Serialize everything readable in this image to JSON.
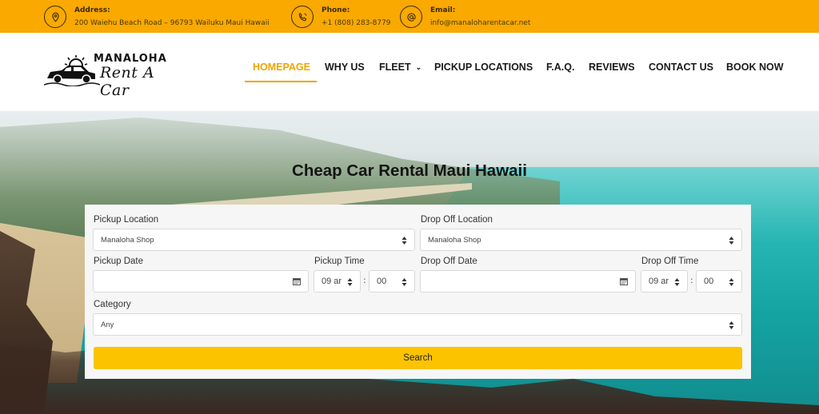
{
  "topbar": {
    "address": {
      "label": "Address:",
      "value": "200 Waiehu Beach Road – 96793 Wailuku Maui Hawaii"
    },
    "phone": {
      "label": "Phone:",
      "value": "+1 (808) 283-8779"
    },
    "email": {
      "label": "Email:",
      "value": "info@manaloharentacar.net"
    },
    "accent_color": "#f9a900"
  },
  "logo": {
    "line1": "MANALOHA",
    "line2": "Rent A Car"
  },
  "nav": {
    "items": [
      {
        "label": "HOMEPAGE",
        "active": true
      },
      {
        "label": "WHY US"
      },
      {
        "label": "FLEET",
        "has_dropdown": true
      },
      {
        "label": "PICKUP LOCATIONS"
      },
      {
        "label": "F.A.Q."
      },
      {
        "label": "REVIEWS"
      },
      {
        "label": "CONTACT US"
      },
      {
        "label": "BOOK NOW"
      }
    ],
    "active_color": "#f0a400"
  },
  "hero": {
    "title": "Cheap Car Rental Maui Hawaii"
  },
  "form": {
    "pickup_location": {
      "label": "Pickup Location",
      "value": "Manaloha Shop"
    },
    "dropoff_location": {
      "label": "Drop Off Location",
      "value": "Manaloha Shop"
    },
    "pickup_date": {
      "label": "Pickup Date",
      "value": ""
    },
    "pickup_time": {
      "label": "Pickup Time",
      "hour": "09 ar",
      "minute": "00"
    },
    "dropoff_date": {
      "label": "Drop Off Date",
      "value": ""
    },
    "dropoff_time": {
      "label": "Drop Off Time",
      "hour": "09 ar",
      "minute": "00"
    },
    "category": {
      "label": "Category",
      "value": "Any"
    },
    "search_label": "Search",
    "button_color": "#fcc300"
  }
}
